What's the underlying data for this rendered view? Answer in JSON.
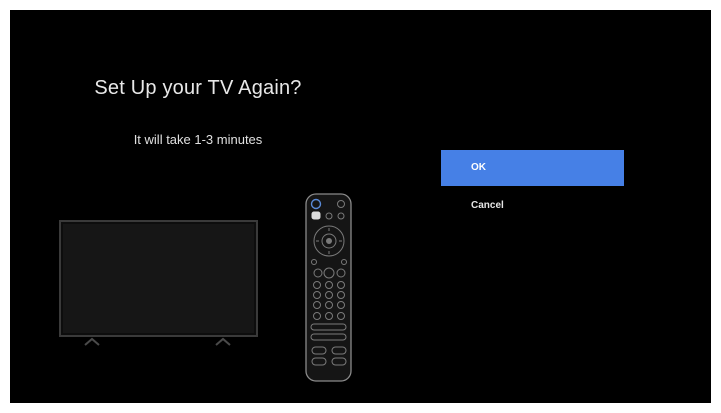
{
  "dialog": {
    "title": "Set Up your TV Again?",
    "subtitle": "It will take 1-3 minutes"
  },
  "options": {
    "ok_label": "OK",
    "cancel_label": "Cancel"
  },
  "illustration": {
    "tv_icon": "tv-icon",
    "remote_icon": "remote-control-icon"
  },
  "colors": {
    "background": "#000000",
    "accent": "#4680e6",
    "text": "#e8e8e8"
  }
}
